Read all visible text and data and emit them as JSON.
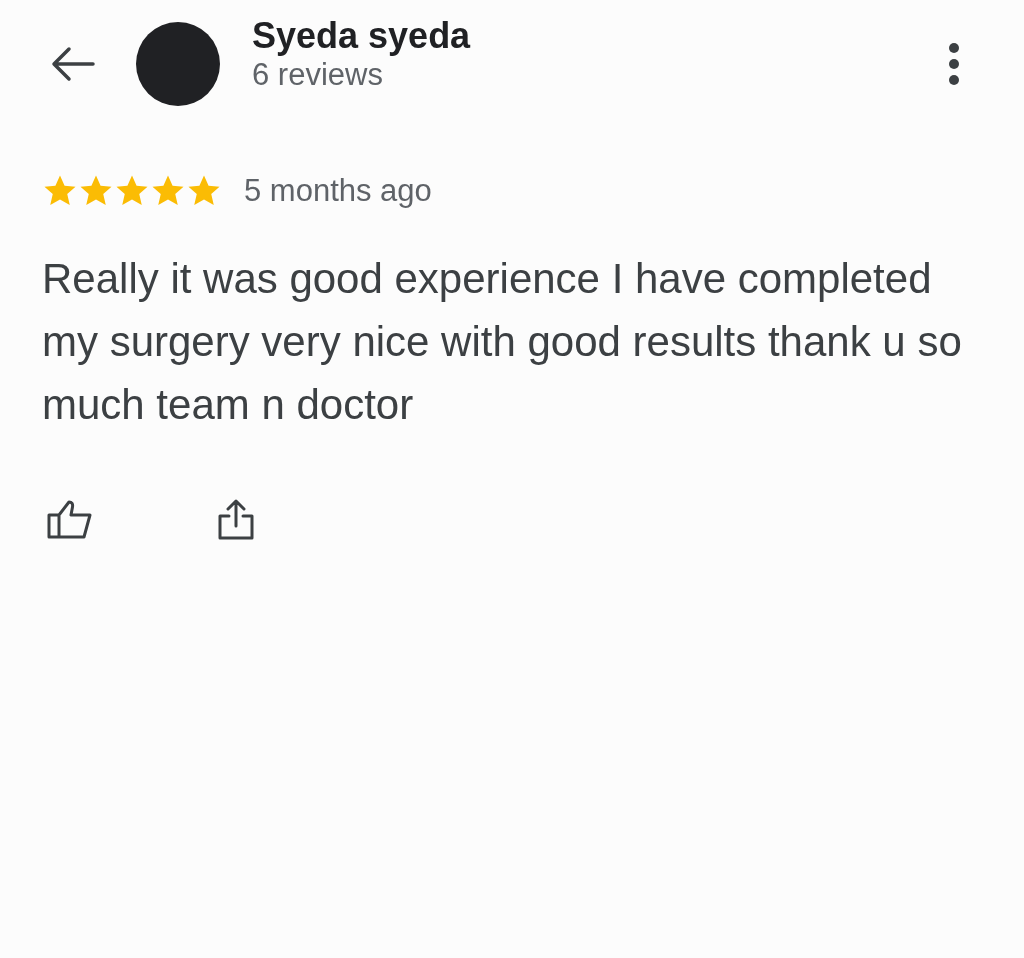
{
  "reviewer": {
    "name": "Syeda syeda",
    "review_count": "6 reviews"
  },
  "review": {
    "stars": 5,
    "time": "5 months ago",
    "text": "Really it was good experience I have completed my surgery very nice with good results thank u so much team n doctor"
  }
}
